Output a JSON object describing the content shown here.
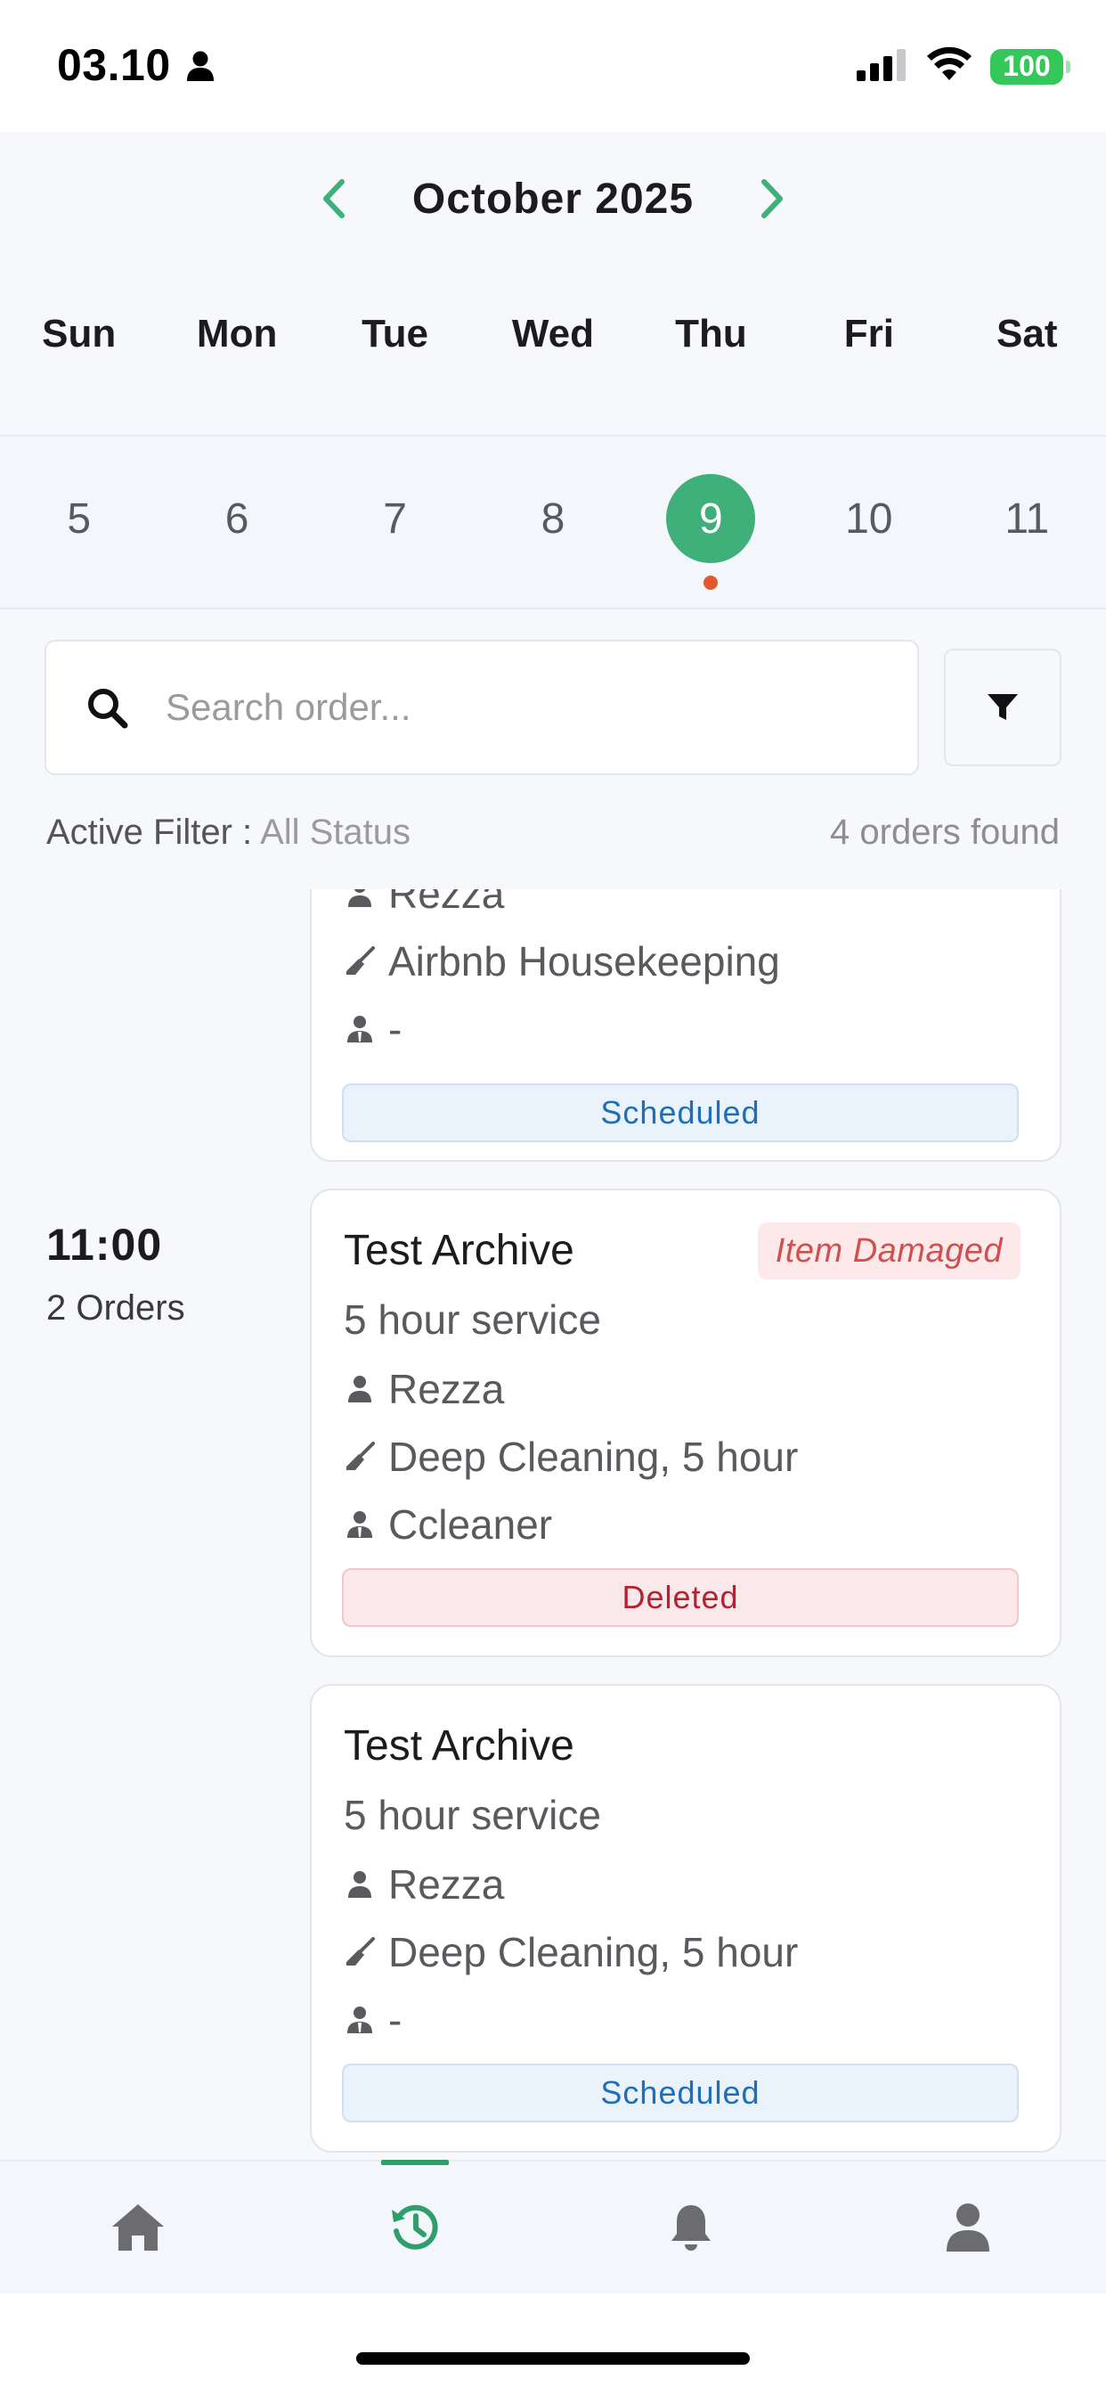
{
  "status_bar": {
    "time": "03.10",
    "battery": "100"
  },
  "calendar": {
    "month_title": "October 2025",
    "weekdays": [
      "Sun",
      "Mon",
      "Tue",
      "Wed",
      "Thu",
      "Fri",
      "Sat"
    ],
    "days": [
      "5",
      "6",
      "7",
      "8",
      "9",
      "10",
      "11"
    ],
    "selected_day": "9"
  },
  "search": {
    "placeholder": "Search order..."
  },
  "filter": {
    "label": "Active Filter :",
    "value": "All Status",
    "count_text": "4 orders found"
  },
  "orders": {
    "partial_card": {
      "customer": "Rezza",
      "service": "Airbnb Housekeeping",
      "cleaner": "-",
      "status": "Scheduled"
    },
    "group_1100": {
      "time": "11:00",
      "count": "2 Orders",
      "cards": [
        {
          "title": "Test Archive",
          "badge": "Item Damaged",
          "duration": "5 hour service",
          "customer": "Rezza",
          "service": "Deep Cleaning, 5 hour",
          "cleaner": "Ccleaner",
          "status": "Deleted"
        },
        {
          "title": "Test Archive",
          "duration": "5 hour service",
          "customer": "Rezza",
          "service": "Deep Cleaning, 5 hour",
          "cleaner": "-",
          "status": "Scheduled"
        }
      ]
    }
  },
  "nav": {
    "items": [
      "home-icon",
      "history-icon",
      "bell-icon",
      "profile-icon"
    ],
    "active": "history-icon"
  },
  "colors": {
    "accent": "#3fb07a",
    "nav_active": "#2e9e6b",
    "dot": "#e05a2a",
    "scheduled": "#1e6fb8",
    "deleted": "#b5212e"
  }
}
